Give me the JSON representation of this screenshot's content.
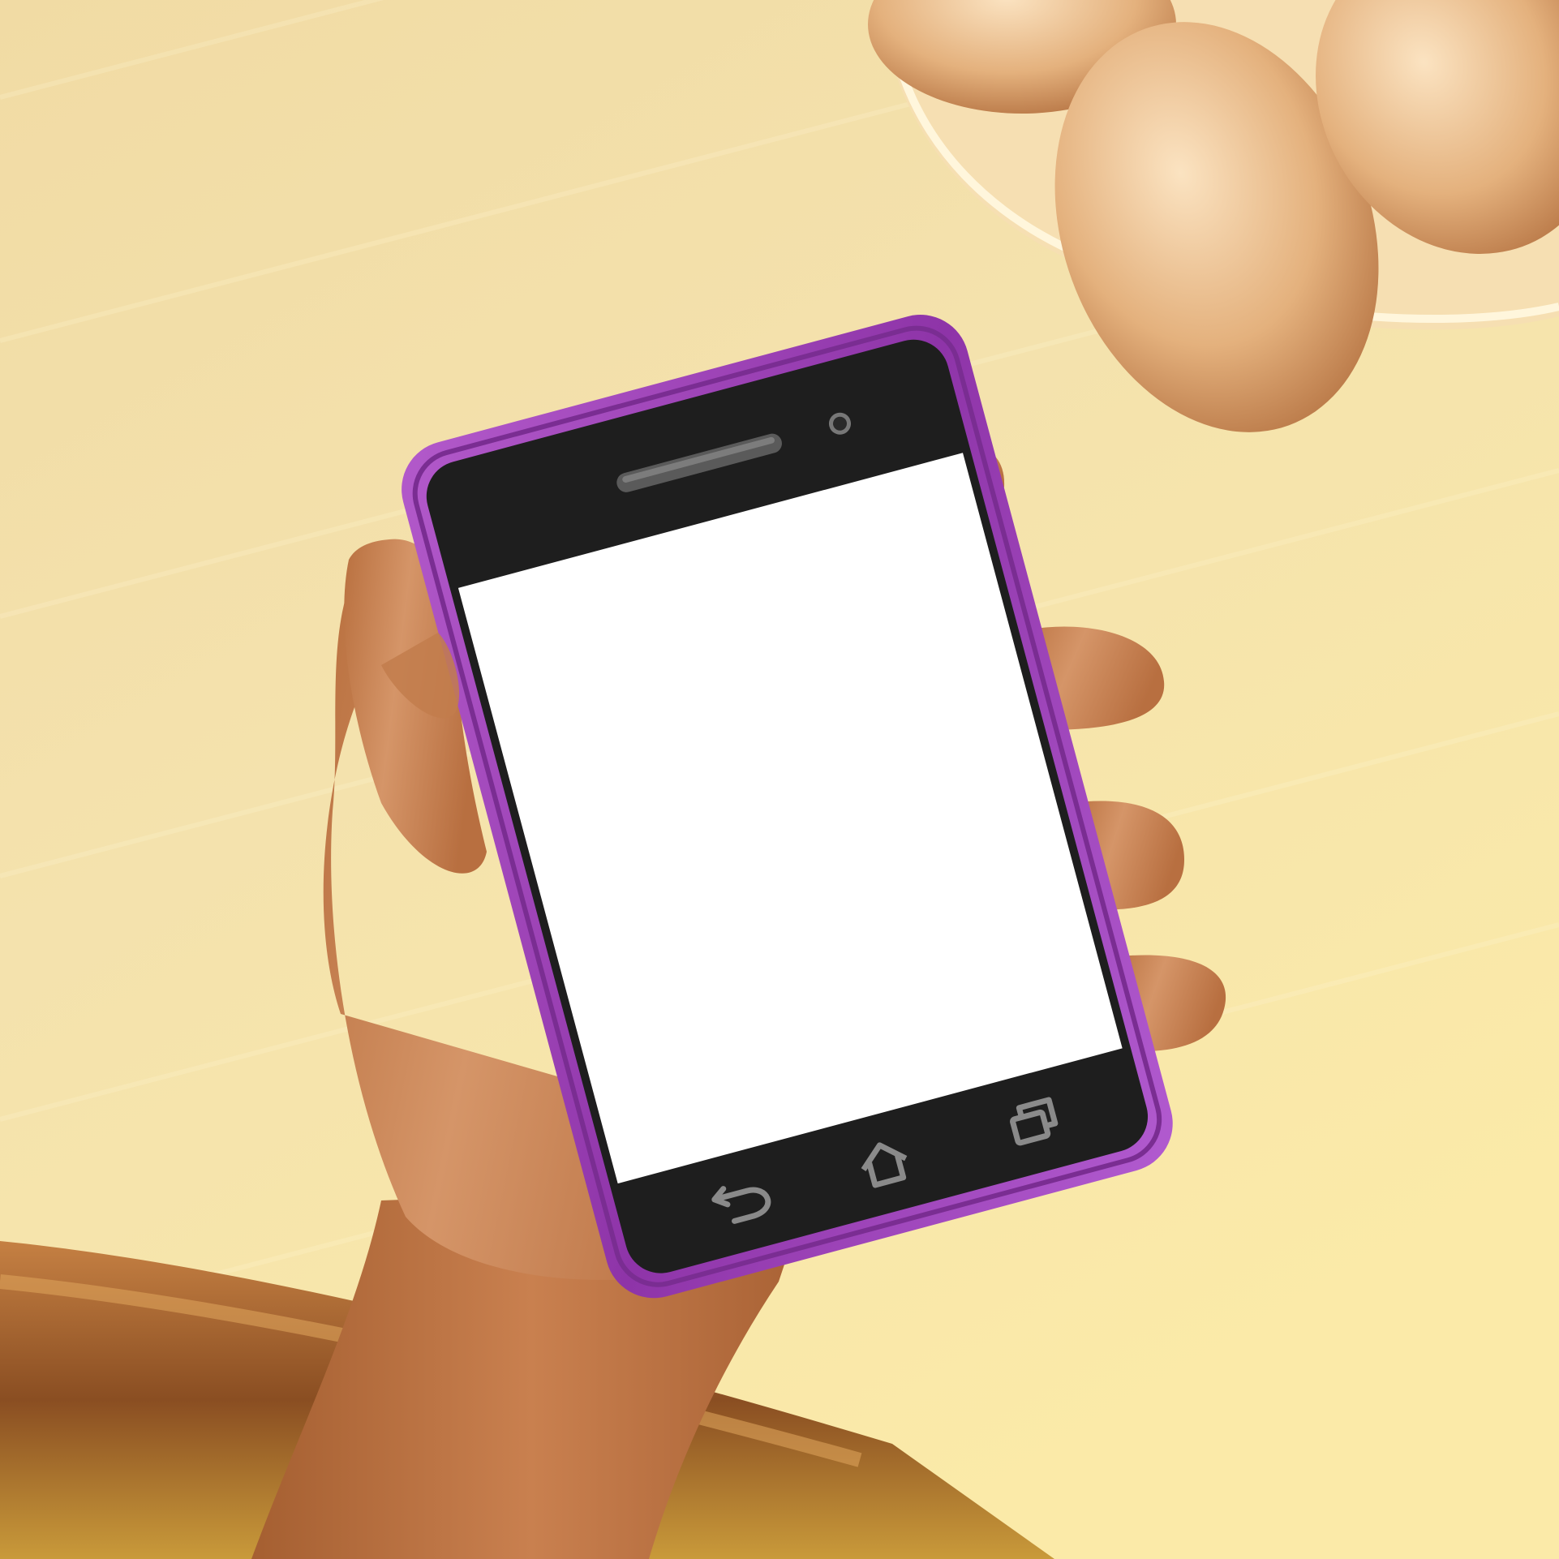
{
  "scene": {
    "description_colors": {
      "background_light": "#f7e6b4",
      "background_mid": "#ecd39a",
      "table_shadow": "#a0642c",
      "skin": "#c9804f",
      "skin_shadow": "#9a5a32",
      "phone_case": "#9a3fb3",
      "phone_case_highlight": "#c775e0",
      "phone_bezel": "#1f1f1f",
      "screen": "#ffffff",
      "nav_icon": "#8a8a8a",
      "cup_rim": "#fff4d6",
      "egg": "#e7b98a"
    }
  },
  "phone": {
    "screen_text": "",
    "nav_buttons": [
      {
        "name": "back",
        "icon": "back-arrow-icon"
      },
      {
        "name": "home",
        "icon": "home-icon"
      },
      {
        "name": "recents",
        "icon": "recent-apps-icon"
      }
    ]
  }
}
